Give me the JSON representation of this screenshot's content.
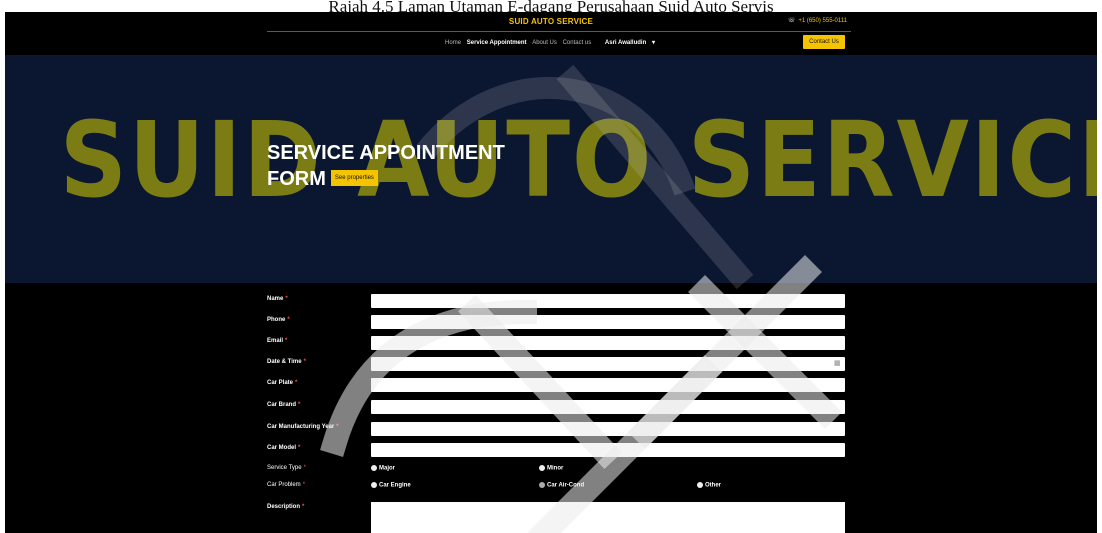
{
  "caption": "Rajah 4.5 Laman Utaman E-dagang Perusahaan Suid Auto Servis",
  "header": {
    "brand": "SUID AUTO SERVICE",
    "phone": "+1 (650) 555-0111",
    "nav": [
      "Home",
      "Service Appointment",
      "About Us",
      "Contact us"
    ],
    "user": "Asri Awalludin",
    "contact_button": "Contact Us"
  },
  "hero": {
    "watermark": "SUID AUTO SERVICE",
    "title_line1": "SERVICE APPOINTMENT",
    "title_line2": "FORM",
    "properties_button": "See properties"
  },
  "form": {
    "fields": [
      {
        "label": "Name",
        "required": "*"
      },
      {
        "label": "Phone",
        "required": "*"
      },
      {
        "label": "Email",
        "required": "*"
      },
      {
        "label": "Date & Time",
        "required": "*"
      },
      {
        "label": "Car Plate",
        "required": "*"
      },
      {
        "label": "Car Brand",
        "required": "*"
      },
      {
        "label": "Car Manufacturing Year",
        "required": "*"
      },
      {
        "label": "Car Model",
        "required": "*"
      }
    ],
    "service_type": {
      "label": "Service Type",
      "required": "*",
      "options": [
        "Major",
        "Minor"
      ]
    },
    "car_problem": {
      "label": "Car Problem",
      "required": "*",
      "options": [
        "Car Engine",
        "Car Air-Cond",
        "Other"
      ]
    },
    "description": {
      "label": "Description",
      "required": "*"
    }
  },
  "colors": {
    "accent": "#f5c400",
    "hero_bg": "#0b1731",
    "watermark": "#7b7c14"
  }
}
